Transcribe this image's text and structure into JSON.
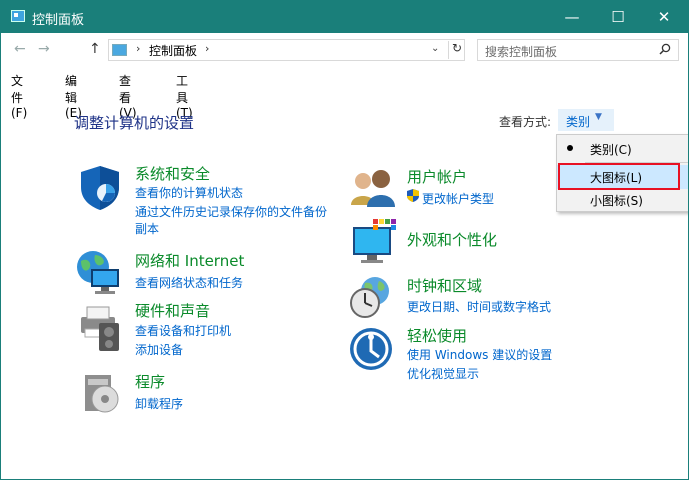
{
  "window": {
    "title": "控制面板",
    "minimize": "—",
    "maximize": "☐",
    "close": "✕"
  },
  "nav": {
    "back": "←",
    "forward": "→",
    "up": "↑"
  },
  "address": {
    "separator": "›",
    "path": "控制面板",
    "dropdown": "⌄",
    "refresh": "↻"
  },
  "search": {
    "placeholder": "搜索控制面板",
    "icon": "search-icon"
  },
  "menu": [
    "文件(F)",
    "编辑(E)",
    "查看(V)",
    "工具(T)"
  ],
  "heading": "调整计算机的设置",
  "viewby": {
    "label": "查看方式:",
    "value": "类别",
    "caret": "▼"
  },
  "dropdown": {
    "items": [
      {
        "label": "类别(C)",
        "selected": true
      },
      {
        "label": "大图标(L)",
        "highlighted": true
      },
      {
        "label": "小图标(S)"
      }
    ]
  },
  "categories": {
    "security": {
      "title": "系统和安全",
      "links": [
        "查看你的计算机状态",
        "通过文件历史记录保存你的文件备份",
        "副本"
      ],
      "icon": "shield-icon"
    },
    "network": {
      "title": "网络和 Internet",
      "links": [
        "查看网络状态和任务"
      ],
      "icon": "network-globe-icon"
    },
    "hardware": {
      "title": "硬件和声音",
      "links": [
        "查看设备和打印机",
        "添加设备"
      ],
      "icon": "printer-speaker-icon"
    },
    "programs": {
      "title": "程序",
      "links": [
        "卸载程序"
      ],
      "icon": "programs-disc-icon"
    },
    "users": {
      "title": "用户帐户",
      "links": [
        "更改帐户类型"
      ],
      "icon": "users-icon"
    },
    "appearance": {
      "title": "外观和个性化",
      "links": [],
      "icon": "monitor-palette-icon"
    },
    "clock": {
      "title": "时钟和区域",
      "links": [
        "更改日期、时间或数字格式"
      ],
      "icon": "clock-globe-icon"
    },
    "ease": {
      "title": "轻松使用",
      "links": [
        "使用 Windows 建议的设置",
        "优化视觉显示"
      ],
      "icon": "ease-of-access-icon"
    }
  },
  "colors": {
    "titlebar": "#1a7f7a",
    "heading": "#1e3287",
    "category": "#0a8a2a",
    "link": "#0066cc",
    "highlight": "#cce8ff",
    "frame": "#e81123"
  }
}
